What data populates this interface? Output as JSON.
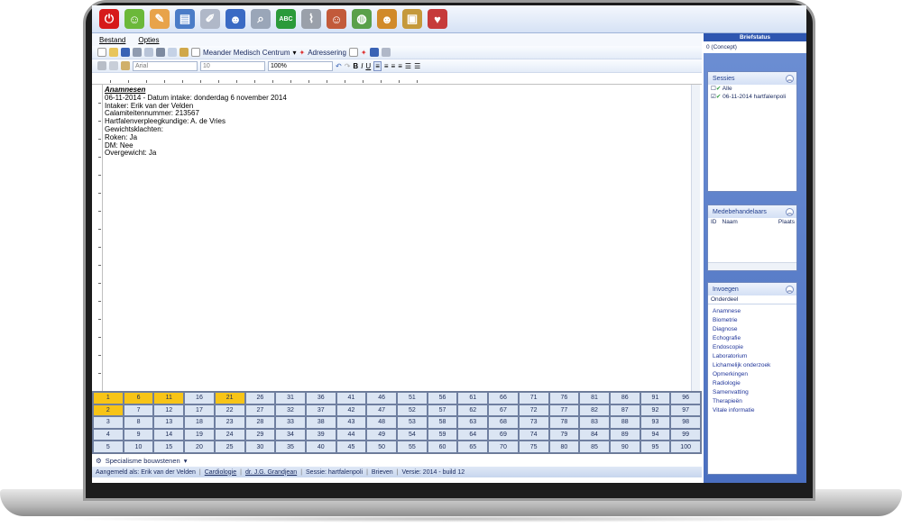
{
  "menu": {
    "bestand": "Bestand",
    "opties": "Opties"
  },
  "toolbar": {
    "location": "Meander Medisch Centrum",
    "adressering": "Adressering",
    "font": "Arial",
    "size": "10",
    "zoom": "100%"
  },
  "document": {
    "heading": "Anamnesen",
    "lines": [
      "06-11-2014    - Datum intake:  donderdag 6 november 2014",
      "Intaker:  Erik van der Velden",
      "Calamiteitennummer:  213567",
      "Hartfalenverpleegkundige:  A. de Vries",
      "Gewichtsklachten:",
      "Roken: Ja",
      "DM: Nee",
      "Overgewicht: Ja"
    ]
  },
  "grid": {
    "rows": [
      [
        "1",
        "6",
        "11",
        "16",
        "21",
        "26",
        "31",
        "36",
        "41",
        "46",
        "51",
        "56",
        "61",
        "66",
        "71",
        "76",
        "81",
        "86",
        "91",
        "96"
      ],
      [
        "2",
        "7",
        "12",
        "17",
        "22",
        "27",
        "32",
        "37",
        "42",
        "47",
        "52",
        "57",
        "62",
        "67",
        "72",
        "77",
        "82",
        "87",
        "92",
        "97"
      ],
      [
        "3",
        "8",
        "13",
        "18",
        "23",
        "28",
        "33",
        "38",
        "43",
        "48",
        "53",
        "58",
        "63",
        "68",
        "73",
        "78",
        "83",
        "88",
        "93",
        "98"
      ],
      [
        "4",
        "9",
        "14",
        "19",
        "24",
        "29",
        "34",
        "39",
        "44",
        "49",
        "54",
        "59",
        "64",
        "69",
        "74",
        "79",
        "84",
        "89",
        "94",
        "99"
      ],
      [
        "5",
        "10",
        "15",
        "20",
        "25",
        "30",
        "35",
        "40",
        "45",
        "50",
        "55",
        "60",
        "65",
        "70",
        "75",
        "80",
        "85",
        "90",
        "95",
        "100"
      ]
    ],
    "highlighted": [
      "1",
      "6",
      "11",
      "21",
      "2"
    ]
  },
  "specialisme": "Specialisme bouwstenen",
  "status": {
    "user": "Aangemeld als: Erik van der Velden",
    "dept": "Cardiologie",
    "doctor": "dr. J.G. Grandjean",
    "session": "Sessie: hartfalenpoli",
    "module": "Brieven",
    "version": "Versie: 2014 - build 12"
  },
  "right": {
    "title": "Briefstatus",
    "concept": "0 (Concept)",
    "sessies": {
      "title": "Sessies",
      "items": [
        "Alle",
        "06-11-2014 hartfalenpoli"
      ]
    },
    "medebehandelaars": {
      "title": "Medebehandelaars",
      "cols": [
        "ID",
        "Naam",
        "Plaats"
      ]
    },
    "invoegen": {
      "title": "Invoegen",
      "header": "Onderdeel",
      "items": [
        "Anamnese",
        "Biometrie",
        "Diagnose",
        "Echografie",
        "Endoscopie",
        "Laboratorium",
        "Lichamelijk onderzoek",
        "Opmerkingen",
        "Radiologie",
        "Samenvatting",
        "Therapieën",
        "Vitale informatie"
      ]
    }
  }
}
